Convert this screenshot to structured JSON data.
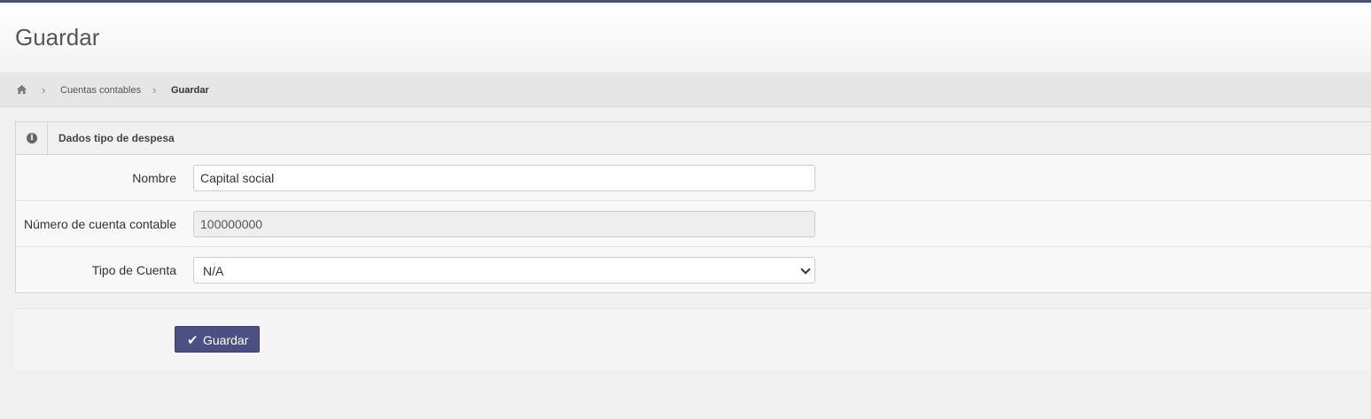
{
  "page": {
    "title": "Guardar"
  },
  "breadcrumb": {
    "home_icon": "home-icon",
    "items": [
      "Cuentas contables",
      "Guardar"
    ],
    "separator": "›"
  },
  "panel": {
    "icon": "info-icon",
    "icon_glyph": "i",
    "title": "Dados tipo de despesa"
  },
  "form": {
    "nombre_label": "Nombre",
    "nombre_value": "Capital social",
    "numero_label": "Número de cuenta contable",
    "numero_value": "100000000",
    "tipo_label": "Tipo de Cuenta",
    "tipo_value": "N/A"
  },
  "actions": {
    "save_icon": "check-icon",
    "save_glyph": "✔",
    "save_label": "Guardar"
  },
  "colors": {
    "accent": "#4a5084",
    "top_line": "#4a4f7e"
  }
}
